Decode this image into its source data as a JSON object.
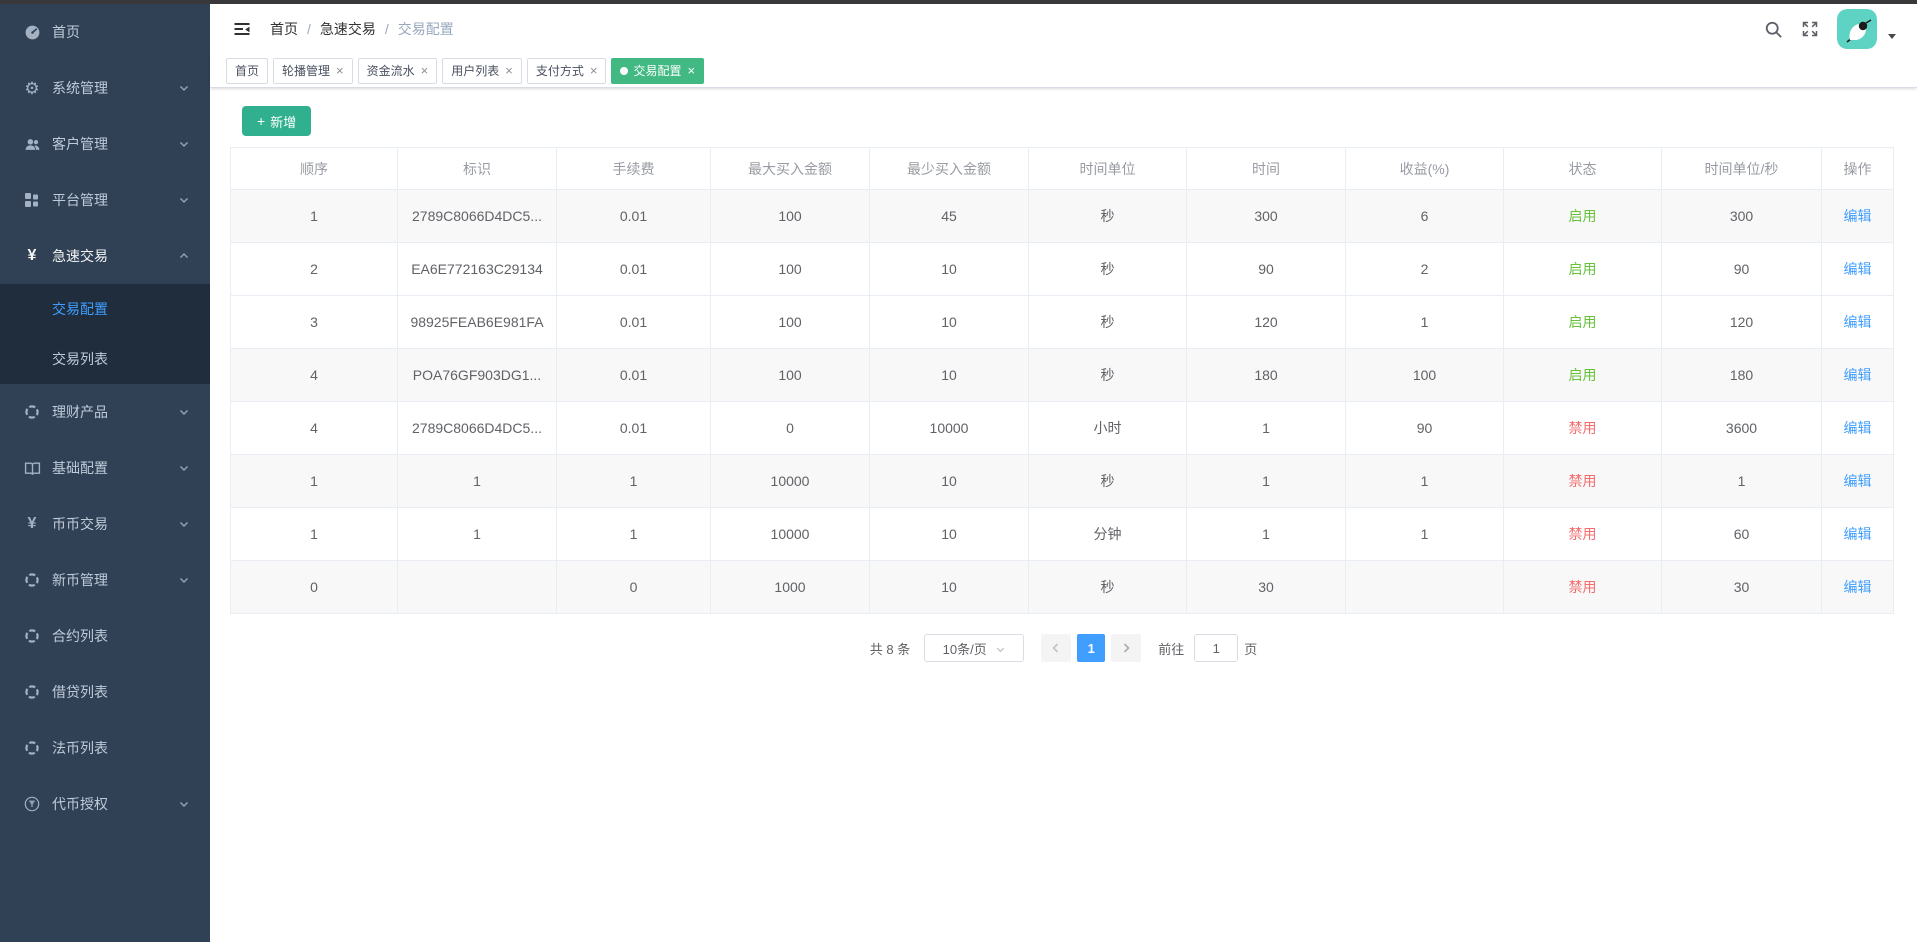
{
  "sidebar": {
    "items": [
      {
        "label": "首页",
        "icon": "dashboard-icon",
        "type": "link"
      },
      {
        "label": "系统管理",
        "icon": "gear-icon",
        "type": "submenu"
      },
      {
        "label": "客户管理",
        "icon": "users-icon",
        "type": "submenu"
      },
      {
        "label": "平台管理",
        "icon": "grid-icon",
        "type": "submenu"
      },
      {
        "label": "急速交易",
        "icon": "yen-icon",
        "type": "submenu",
        "expanded": true,
        "active": true,
        "children": [
          {
            "label": "交易配置",
            "active": true
          },
          {
            "label": "交易列表",
            "active": false
          }
        ]
      },
      {
        "label": "理财产品",
        "icon": "target-icon",
        "type": "submenu"
      },
      {
        "label": "基础配置",
        "icon": "book-icon",
        "type": "submenu"
      },
      {
        "label": "币币交易",
        "icon": "yen-icon",
        "type": "submenu"
      },
      {
        "label": "新币管理",
        "icon": "target-icon",
        "type": "submenu"
      },
      {
        "label": "合约列表",
        "icon": "target-icon",
        "type": "link"
      },
      {
        "label": "借贷列表",
        "icon": "target-icon",
        "type": "link"
      },
      {
        "label": "法币列表",
        "icon": "target-icon",
        "type": "link"
      },
      {
        "label": "代币授权",
        "icon": "token-icon",
        "type": "submenu"
      }
    ]
  },
  "navbar": {
    "separator": "/",
    "breadcrumb": [
      {
        "label": "首页",
        "current": false
      },
      {
        "label": "急速交易",
        "current": false
      },
      {
        "label": "交易配置",
        "current": true
      }
    ]
  },
  "tags": [
    {
      "label": "首页",
      "closable": false,
      "active": false
    },
    {
      "label": "轮播管理",
      "closable": true,
      "active": false
    },
    {
      "label": "资金流水",
      "closable": true,
      "active": false
    },
    {
      "label": "用户列表",
      "closable": true,
      "active": false
    },
    {
      "label": "支付方式",
      "closable": true,
      "active": false
    },
    {
      "label": "交易配置",
      "closable": true,
      "active": true
    }
  ],
  "toolbar": {
    "add_label": "新增",
    "plus": "+"
  },
  "table": {
    "headers": [
      "顺序",
      "标识",
      "手续费",
      "最大买入金额",
      "最少买入金额",
      "时间单位",
      "时间",
      "收益(%)",
      "状态",
      "时间单位/秒",
      "操作"
    ],
    "rows": [
      {
        "cells": [
          "1",
          "2789C8066D4DC5...",
          "0.01",
          "100",
          "45",
          "秒",
          "300",
          "6",
          "启用",
          "300",
          "编辑"
        ],
        "status_type": "enabled",
        "shaded": true
      },
      {
        "cells": [
          "2",
          "EA6E772163C29134",
          "0.01",
          "100",
          "10",
          "秒",
          "90",
          "2",
          "启用",
          "90",
          "编辑"
        ],
        "status_type": "enabled",
        "shaded": false
      },
      {
        "cells": [
          "3",
          "98925FEAB6E981FA",
          "0.01",
          "100",
          "10",
          "秒",
          "120",
          "1",
          "启用",
          "120",
          "编辑"
        ],
        "status_type": "enabled",
        "shaded": false
      },
      {
        "cells": [
          "4",
          "POA76GF903DG1...",
          "0.01",
          "100",
          "10",
          "秒",
          "180",
          "100",
          "启用",
          "180",
          "编辑"
        ],
        "status_type": "enabled",
        "shaded": true
      },
      {
        "cells": [
          "4",
          "2789C8066D4DC5...",
          "0.01",
          "0",
          "10000",
          "小时",
          "1",
          "90",
          "禁用",
          "3600",
          "编辑"
        ],
        "status_type": "disabled",
        "shaded": false
      },
      {
        "cells": [
          "1",
          "1",
          "1",
          "10000",
          "10",
          "秒",
          "1",
          "1",
          "禁用",
          "1",
          "编辑"
        ],
        "status_type": "disabled",
        "shaded": true
      },
      {
        "cells": [
          "1",
          "1",
          "1",
          "10000",
          "10",
          "分钟",
          "1",
          "1",
          "禁用",
          "60",
          "编辑"
        ],
        "status_type": "disabled",
        "shaded": false
      },
      {
        "cells": [
          "0",
          "",
          "0",
          "1000",
          "10",
          "秒",
          "30",
          "",
          "禁用",
          "30",
          "编辑"
        ],
        "status_type": "disabled",
        "shaded": true
      }
    ]
  },
  "pagination": {
    "total": "共 8 条",
    "page_size": "10条/页",
    "current_page": "1",
    "goto_label": "前往",
    "goto_value": "1",
    "goto_suffix": "页"
  },
  "colors": {
    "sidebar_bg": "#304156",
    "submenu_bg": "#1f2d3d",
    "active_link_blue": "#409eff",
    "tag_active_green": "#42b983",
    "add_button_green": "#30b08f",
    "status_enabled_green": "#67c23a",
    "status_disabled_red": "#f56c6c",
    "avatar_bg_teal": "#5ed3c3"
  }
}
